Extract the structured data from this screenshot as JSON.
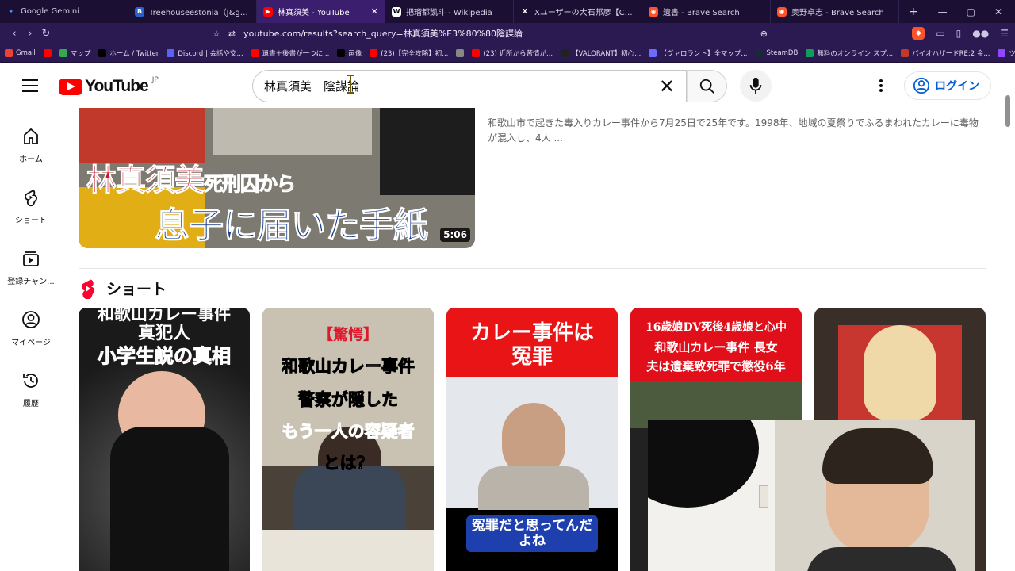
{
  "browser": {
    "tabs": [
      {
        "label": "Google Gemini",
        "color": "#4f8cff",
        "glyph": "✦"
      },
      {
        "label": "Treehouseestonia（J&gisoo）: (& ",
        "color": "#2a62c9",
        "glyph": "B"
      },
      {
        "label": "林真須美 - YouTube",
        "color": "#ff0000",
        "glyph": "▶",
        "active": true
      },
      {
        "label": "把瑠都凱斗 - Wikipedia",
        "color": "#ffffff",
        "glyph": "W"
      },
      {
        "label": "Xユーザーの大石邦彦【CBCテレビ解説委",
        "color": "#000000",
        "glyph": "X"
      },
      {
        "label": "遺書 - Brave Search",
        "color": "#fb542b",
        "glyph": "◉"
      },
      {
        "label": "奥野卓志 - Brave Search",
        "color": "#fb542b",
        "glyph": "◉"
      }
    ],
    "new_tab": "+",
    "window_controls": [
      "—",
      "▢",
      "✕"
    ],
    "url": "youtube.com/results?search_query=林真須美%E3%80%80陰謀論",
    "bookmarks": [
      {
        "label": "Gmail",
        "color": "#ea4335"
      },
      {
        "label": "",
        "color": "#ff0000"
      },
      {
        "label": "マップ",
        "color": "#34a853"
      },
      {
        "label": "ホーム / Twitter",
        "color": "#000000"
      },
      {
        "label": "Discord | 会話や交...",
        "color": "#5865f2"
      },
      {
        "label": "遺書＋後書が一つに...",
        "color": "#ff0000"
      },
      {
        "label": "画像",
        "color": "#000000"
      },
      {
        "label": "(23)【完全攻略】初...",
        "color": "#ff0000"
      },
      {
        "label": "",
        "color": "#888888"
      },
      {
        "label": "(23) 近所から苦情が...",
        "color": "#ff0000"
      },
      {
        "label": "【VALORANT】初心...",
        "color": "#222222"
      },
      {
        "label": "【ヴァロラント】全マップ...",
        "color": "#6b6bff"
      },
      {
        "label": "SteamDB",
        "color": "#1b2838"
      },
      {
        "label": "無料のオンライン スプ...",
        "color": "#0f9d58"
      },
      {
        "label": "バイオハザードRE:2 金...",
        "color": "#c0392b"
      },
      {
        "label": "ツイッチ関連",
        "color": "#9146ff"
      }
    ]
  },
  "youtube": {
    "logo_text": "YouTube",
    "region": "JP",
    "search_query": "林真須美　陰謀論",
    "login_label": "ログイン",
    "sidebar": [
      {
        "label": "ホーム",
        "icon": "home-icon"
      },
      {
        "label": "ショート",
        "icon": "shorts-icon"
      },
      {
        "label": "登録チャン...",
        "icon": "subscriptions-icon"
      },
      {
        "label": "マイページ",
        "icon": "you-icon"
      },
      {
        "label": "履歴",
        "icon": "history-icon"
      }
    ],
    "video": {
      "thumb_line1": "林真須美",
      "thumb_line1_small": "死刑囚から",
      "thumb_line2": "息子に届いた手紙",
      "duration": "5:06",
      "description": "和歌山市で起きた毒入りカレー事件から7月25日で25年です。1998年、地域の夏祭りでふるまわれたカレーに毒物が混入し、4人 ..."
    },
    "shorts_label": "ショート",
    "shorts": [
      {
        "lines": [
          "和歌山カレー事件",
          "真犯人",
          "小学生説の真相"
        ]
      },
      {
        "lines": [
          "【驚愕】",
          "和歌山カレー事件",
          "警察が隠した",
          "もう一人の容疑者",
          "とは？"
        ]
      },
      {
        "lines": [
          "カレー事件は",
          "冤罪"
        ],
        "caption": "冤罪だと思ってんだよね"
      },
      {
        "lines": [
          "16歳娘DV死後4歳娘と心中",
          "和歌山カレー事件 長女",
          "夫は遺棄致死罪で懲役6年"
        ]
      },
      {
        "lines": []
      }
    ]
  }
}
